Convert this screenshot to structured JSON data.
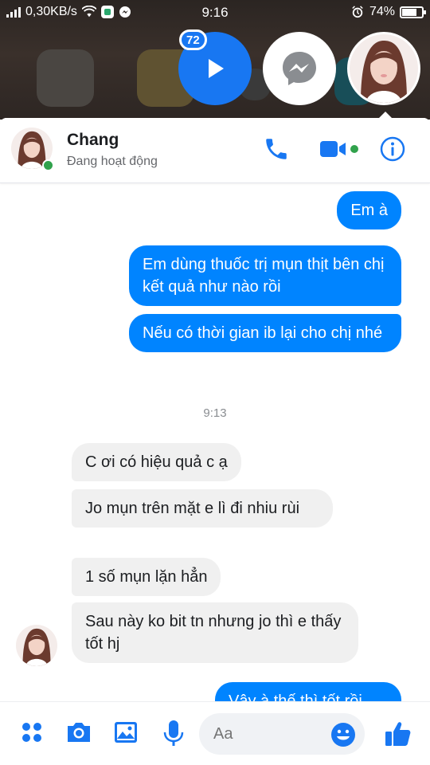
{
  "status_bar": {
    "network_speed": "0,30KB/s",
    "time": "9:16",
    "battery_percent": "74%",
    "battery_level": 0.74
  },
  "chat_heads": {
    "video_badge_count": "72"
  },
  "contact": {
    "name": "Chang",
    "status": "Đang hoạt động"
  },
  "messages": [
    {
      "direction": "outgoing",
      "text": "Em à"
    },
    {
      "direction": "outgoing",
      "text": "Em dùng thuốc trị mụn thịt bên chị kết quả như nào rồi"
    },
    {
      "direction": "outgoing",
      "text": "Nếu có thời gian ib lại cho chị nhé"
    },
    {
      "direction": "timestamp",
      "text": "9:13"
    },
    {
      "direction": "incoming",
      "text": "C ơi có hiệu quả c ạ"
    },
    {
      "direction": "incoming",
      "text": "Jo mụn trên mặt e lì đi nhiu rùi"
    },
    {
      "direction": "incoming",
      "text": "1 số mụn lặn hẳn"
    },
    {
      "direction": "incoming",
      "text": "Sau này ko bit tn nhưng jo thì e thấy tốt hj"
    },
    {
      "direction": "outgoing",
      "text": "Vậy à thế thì tốt rồi"
    }
  ],
  "composer": {
    "placeholder": "Aa"
  },
  "colors": {
    "messenger_blue": "#0084ff",
    "icon_blue": "#1877f2",
    "incoming_bubble": "#f0f0f0",
    "online_green": "#31a24c"
  },
  "icons": [
    "wifi-icon",
    "messenger-icon",
    "alarm-icon",
    "battery-icon",
    "play-icon",
    "phone-icon",
    "video-camera-icon",
    "info-icon",
    "apps-grid-icon",
    "camera-icon",
    "image-icon",
    "microphone-icon",
    "emoji-icon",
    "thumbs-up-icon"
  ]
}
